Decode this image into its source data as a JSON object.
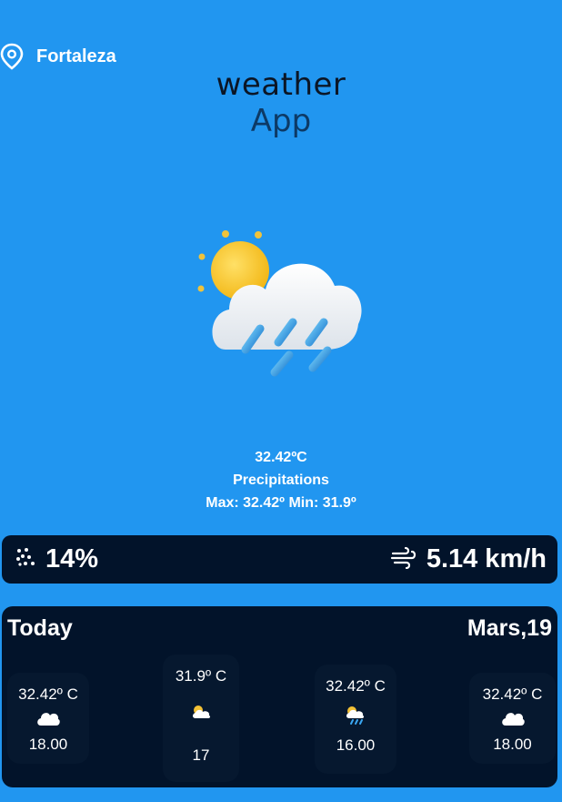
{
  "header": {
    "location": "Fortaleza",
    "icon": "map-pin-icon",
    "title_line1": "weather",
    "title_line2": "App"
  },
  "current": {
    "icon": "sun-cloud-rain-icon",
    "temperature": "32.42ºC",
    "condition": "Precipitations",
    "max_min": "Max: 32.42º  Min: 31.9º"
  },
  "stats": {
    "precipitation": {
      "icon": "rain-drops-icon",
      "value": "14%"
    },
    "wind": {
      "icon": "wind-icon",
      "value": "5.14 km/h"
    }
  },
  "forecast": {
    "label": "Today",
    "date": "Mars,19",
    "items": [
      {
        "temp": "32.42º C",
        "icon": "cloud-icon",
        "value": "18.00"
      },
      {
        "temp": "31.9º C",
        "icon": "sun-cloud-icon",
        "value": "17"
      },
      {
        "temp": "32.42º C",
        "icon": "sun-cloud-rain-icon",
        "value": "16.00"
      },
      {
        "temp": "32.42º C",
        "icon": "cloud-icon",
        "value": "18.00"
      }
    ]
  },
  "colors": {
    "background": "#2196f0",
    "panel": "#02132a",
    "card": "#06182f",
    "title_dark": "#0b1626",
    "title_blue": "#0d3a66"
  }
}
